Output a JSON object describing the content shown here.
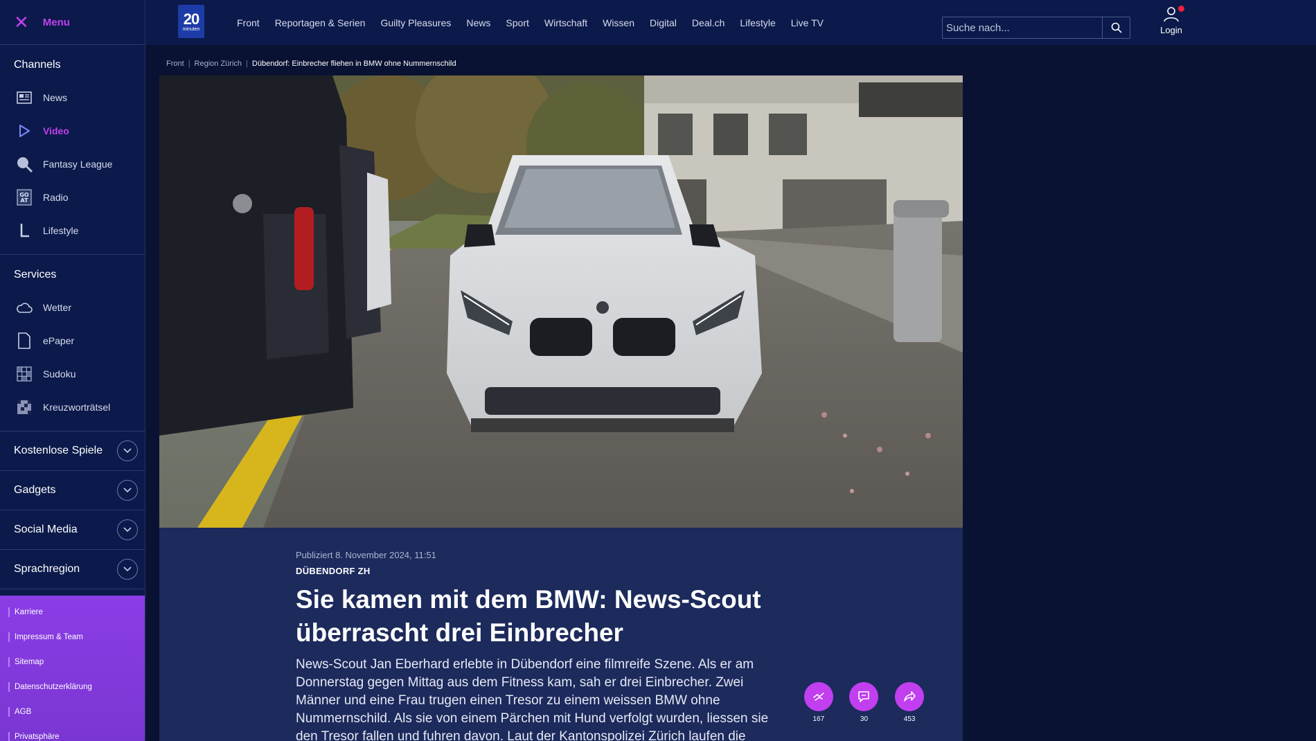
{
  "menu": {
    "label": "Menu"
  },
  "channels": {
    "title": "Channels",
    "items": [
      {
        "label": "News",
        "icon": "newspaper-icon"
      },
      {
        "label": "Video",
        "icon": "play-icon",
        "active": true
      },
      {
        "label": "Fantasy League",
        "icon": "fantasy-league-icon"
      },
      {
        "label": "Radio",
        "icon": "radio-icon"
      },
      {
        "label": "Lifestyle",
        "icon": "lifestyle-icon"
      }
    ]
  },
  "services": {
    "title": "Services",
    "items": [
      {
        "label": "Wetter",
        "icon": "cloud-icon"
      },
      {
        "label": "ePaper",
        "icon": "document-icon"
      },
      {
        "label": "Sudoku",
        "icon": "sudoku-icon"
      },
      {
        "label": "Kreuzworträtsel",
        "icon": "crossword-icon"
      }
    ]
  },
  "accordions": [
    "Kostenlose Spiele",
    "Gadgets",
    "Social Media",
    "Sprachregion"
  ],
  "footer_links": [
    "Karriere",
    "Impressum & Team",
    "Sitemap",
    "Datenschutzerklärung",
    "AGB",
    "Privatsphäre"
  ],
  "header": {
    "logo_number": "20",
    "logo_text": "minuten",
    "nav": [
      "Front",
      "Reportagen & Serien",
      "Guilty Pleasures",
      "News",
      "Sport",
      "Wirtschaft",
      "Wissen",
      "Digital",
      "Deal.ch",
      "Lifestyle",
      "Live TV"
    ],
    "search_placeholder": "Suche nach...",
    "login_label": "Login"
  },
  "breadcrumb": [
    "Front",
    "Region Zürich",
    "Dübendorf: Einbrecher fliehen in BMW ohne Nummernschild"
  ],
  "article": {
    "published": "Publiziert 8. November 2024, 11:51",
    "kicker": "DÜBENDORF ZH",
    "title": "Sie kamen mit dem BMW: News-Scout überrascht drei Einbrecher",
    "lead": "News-Scout Jan Eberhard erlebte in Dübendorf eine filmreife Szene. Als er am Donnerstag gegen Mittag aus dem Fitness kam, sah er drei Einbrecher. Zwei Männer und eine Frau trugen einen Tresor zu einem weissen BMW ohne Nummernschild. Als sie von einem Pärchen mit Hund verfolgt wurden, liessen sie den Tresor fallen und fuhren davon. Laut der Kantonspolizei Zürich laufen die Ermittlungen."
  },
  "actions": {
    "reactions": "167",
    "comments": "30",
    "shares": "453"
  },
  "colors": {
    "accent": "#c23ff0",
    "sidebar_bg": "#0b1a4a",
    "page_bg": "#0a1233",
    "article_bg": "#1c2a5c",
    "footer_bg": "#8b3de6"
  }
}
